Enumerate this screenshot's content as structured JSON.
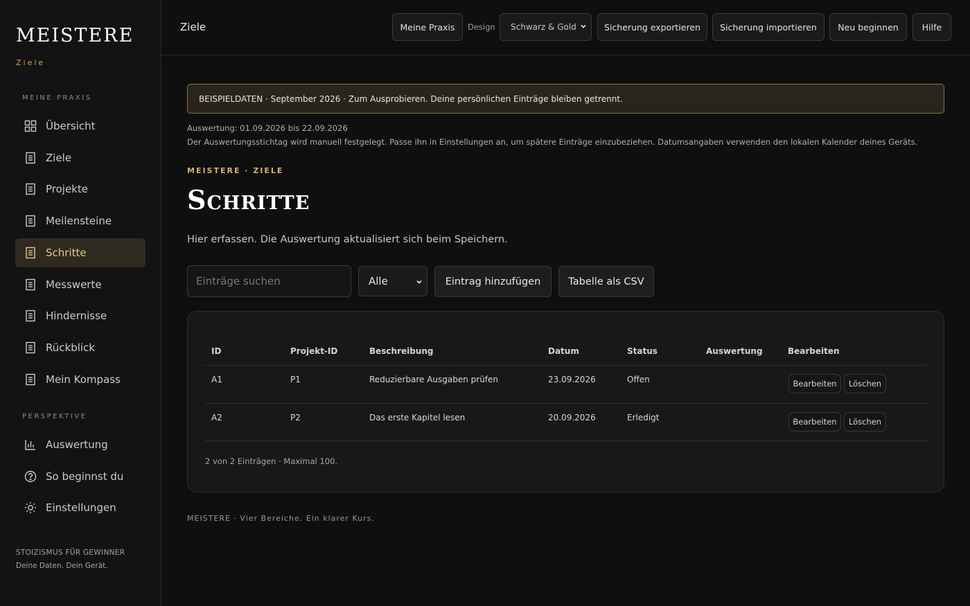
{
  "sidebar": {
    "brand": "MEISTERE",
    "brand_sub": "Ziele",
    "section1_label": "MEINE PRAXIS",
    "section2_label": "PERSPEKTIVE",
    "items": [
      {
        "label": "Übersicht",
        "icon": "grid-icon"
      },
      {
        "label": "Ziele",
        "icon": "document-icon"
      },
      {
        "label": "Projekte",
        "icon": "document-icon"
      },
      {
        "label": "Meilensteine",
        "icon": "document-icon"
      },
      {
        "label": "Schritte",
        "icon": "document-icon",
        "active": true
      },
      {
        "label": "Messwerte",
        "icon": "document-icon"
      },
      {
        "label": "Hindernisse",
        "icon": "document-icon"
      },
      {
        "label": "Rückblick",
        "icon": "document-icon"
      },
      {
        "label": "Mein Kompass",
        "icon": "document-icon"
      }
    ],
    "items2": [
      {
        "label": "Auswertung",
        "icon": "bar-chart-icon"
      },
      {
        "label": "So beginnst du",
        "icon": "help-circle-icon"
      },
      {
        "label": "Einstellungen",
        "icon": "sun-icon"
      }
    ],
    "footer_line1": "STOIZISMUS FÜR GEWINNER",
    "footer_line2": "Deine Daten. Dein Gerät."
  },
  "header": {
    "title": "Ziele",
    "btn_praxis": "Meine Praxis",
    "design_label": "Design",
    "design_value": "Schwarz & Gold",
    "btn_export": "Sicherung exportieren",
    "btn_import": "Sicherung importieren",
    "btn_reset": "Neu beginnen",
    "btn_help": "Hilfe"
  },
  "main": {
    "banner": "BEISPIELDATEN · September 2026 · Zum Ausprobieren. Deine persönlichen Einträge bleiben getrennt.",
    "meta_range": "Auswertung: 01.09.2026 bis 22.09.2026",
    "meta_note": "Der Auswertungsstichtag wird manuell festgelegt. Passe ihn in Einstellungen an, um spätere Einträge einzubeziehen. Datumsangaben verwenden den lokalen Kalender deines Geräts.",
    "eyebrow": "MEISTERE · ZIELE",
    "title": "Schritte",
    "subtitle": "Hier erfassen. Die Auswertung aktualisiert sich beim Speichern.",
    "search_placeholder": "Einträge suchen",
    "filter_value": "Alle",
    "btn_add": "Eintrag hinzufügen",
    "btn_csv": "Tabelle als CSV"
  },
  "table": {
    "headers": [
      "ID",
      "Projekt-ID",
      "Beschreibung",
      "Datum",
      "Status",
      "Auswertung",
      "Bearbeiten"
    ],
    "rows": [
      {
        "id": "A1",
        "project": "P1",
        "desc": "Reduzierbare Ausgaben prüfen",
        "date": "23.09.2026",
        "status": "Offen",
        "eval": ""
      },
      {
        "id": "A2",
        "project": "P2",
        "desc": "Das erste Kapitel lesen",
        "date": "20.09.2026",
        "status": "Erledigt",
        "eval": ""
      }
    ],
    "edit_label": "Bearbeiten",
    "delete_label": "Löschen",
    "count": "2 von 2 Einträgen · Maximal 100."
  },
  "footer": "MEISTERE · Vier Bereiche. Ein klarer Kurs.",
  "colors": {
    "accent": "#c9a55a",
    "background": "#0f0f0f",
    "active_bg": "#2f2a20"
  }
}
